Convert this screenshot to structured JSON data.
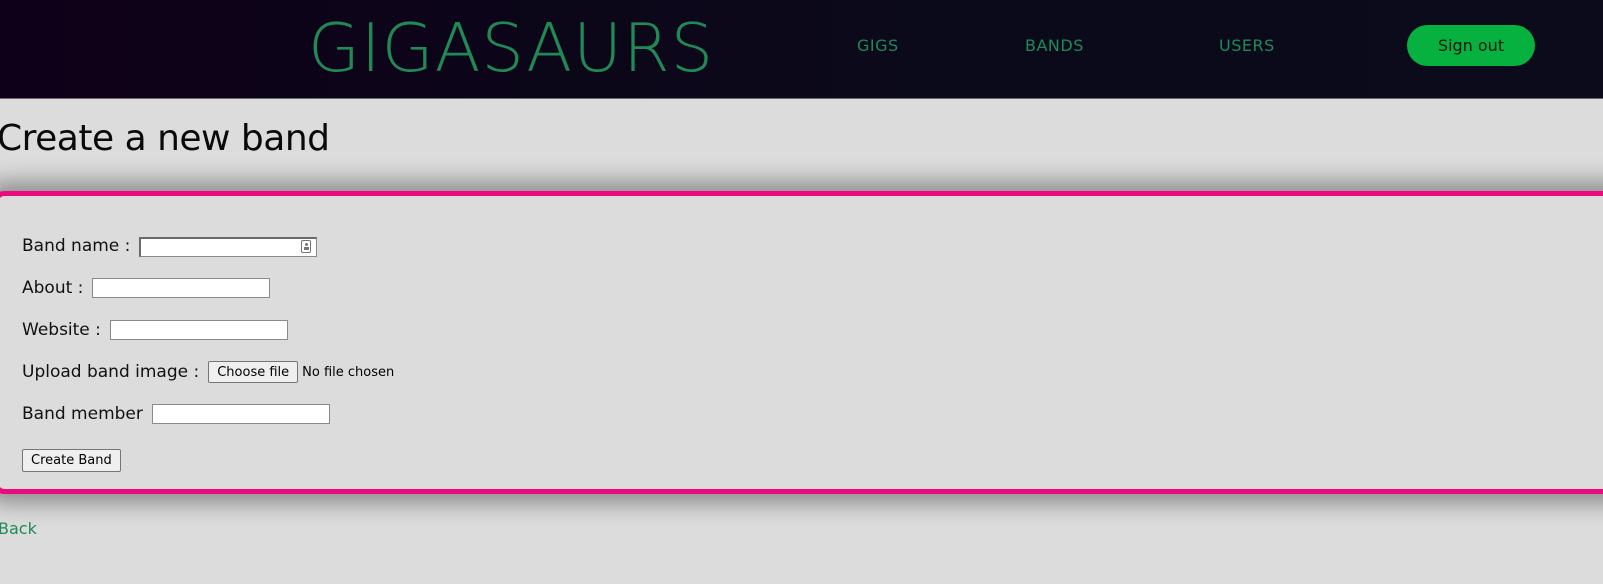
{
  "header": {
    "logo": "GIGASAURS",
    "nav": [
      {
        "label": "GIGS"
      },
      {
        "label": "BANDS"
      },
      {
        "label": "USERS"
      }
    ],
    "signout_label": "Sign out"
  },
  "page": {
    "title": "Create a new band"
  },
  "form": {
    "fields": {
      "band_name": {
        "label": "Band name :",
        "value": ""
      },
      "about": {
        "label": "About :",
        "value": ""
      },
      "website": {
        "label": "Website :",
        "value": ""
      },
      "image": {
        "label": "Upload band image :",
        "button_label": "Choose file",
        "status": "No file chosen"
      },
      "member": {
        "label": "Band member",
        "value": ""
      }
    },
    "submit_label": "Create Band"
  },
  "footer": {
    "back_label": "Back"
  },
  "colors": {
    "accent_pink": "#ec0b7e",
    "brand_green": "#1f8a55",
    "signout_green": "#07b13f",
    "header_bg": "#0d0618",
    "page_bg": "#dcdcdc"
  },
  "icons": {
    "band_name_autofill": "contact-card-icon"
  }
}
